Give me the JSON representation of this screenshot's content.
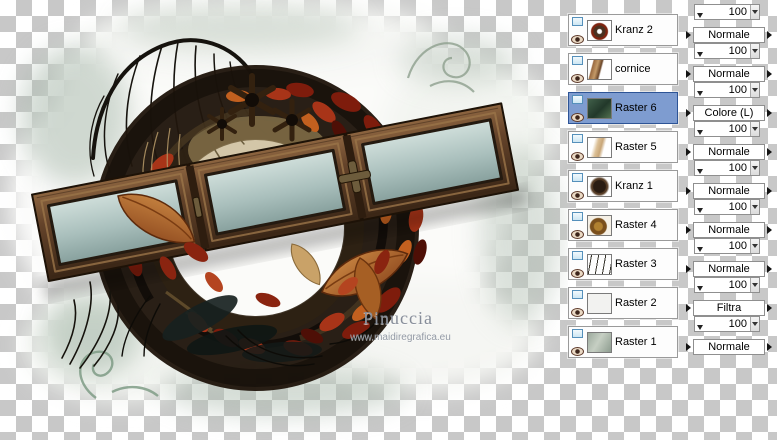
{
  "colors": {
    "selection_blue": "#7e9cd0",
    "checker_light": "#ffffff",
    "checker_dark": "#c8c8c8",
    "panel_border": "#8f8f8f"
  },
  "canvas": {
    "watermark_name": "Pinuccia",
    "watermark_url": "www.maidiregrafica.eu"
  },
  "layers_panel": {
    "layers": [
      {
        "name": "Kranz 2",
        "opacity": "100",
        "blend_mode": "Normale",
        "selected": false,
        "thumb": "kranz2"
      },
      {
        "name": "cornice",
        "opacity": "100",
        "blend_mode": "Normale",
        "selected": false,
        "thumb": "cornice"
      },
      {
        "name": "Raster 6",
        "opacity": "100",
        "blend_mode": "Colore (L)",
        "selected": true,
        "thumb": "raster6"
      },
      {
        "name": "Raster 5",
        "opacity": "100",
        "blend_mode": "Normale",
        "selected": false,
        "thumb": "raster5"
      },
      {
        "name": "Kranz 1",
        "opacity": "100",
        "blend_mode": "Normale",
        "selected": false,
        "thumb": "kranz1"
      },
      {
        "name": "Raster 4",
        "opacity": "100",
        "blend_mode": "Normale",
        "selected": false,
        "thumb": "raster4"
      },
      {
        "name": "Raster 3",
        "opacity": "100",
        "blend_mode": "Normale",
        "selected": false,
        "thumb": "raster3"
      },
      {
        "name": "Raster 2",
        "opacity": "100",
        "blend_mode": "Filtra",
        "selected": false,
        "thumb": "raster2"
      },
      {
        "name": "Raster 1",
        "opacity": "100",
        "blend_mode": "Normale",
        "selected": false,
        "thumb": "raster1"
      }
    ]
  }
}
